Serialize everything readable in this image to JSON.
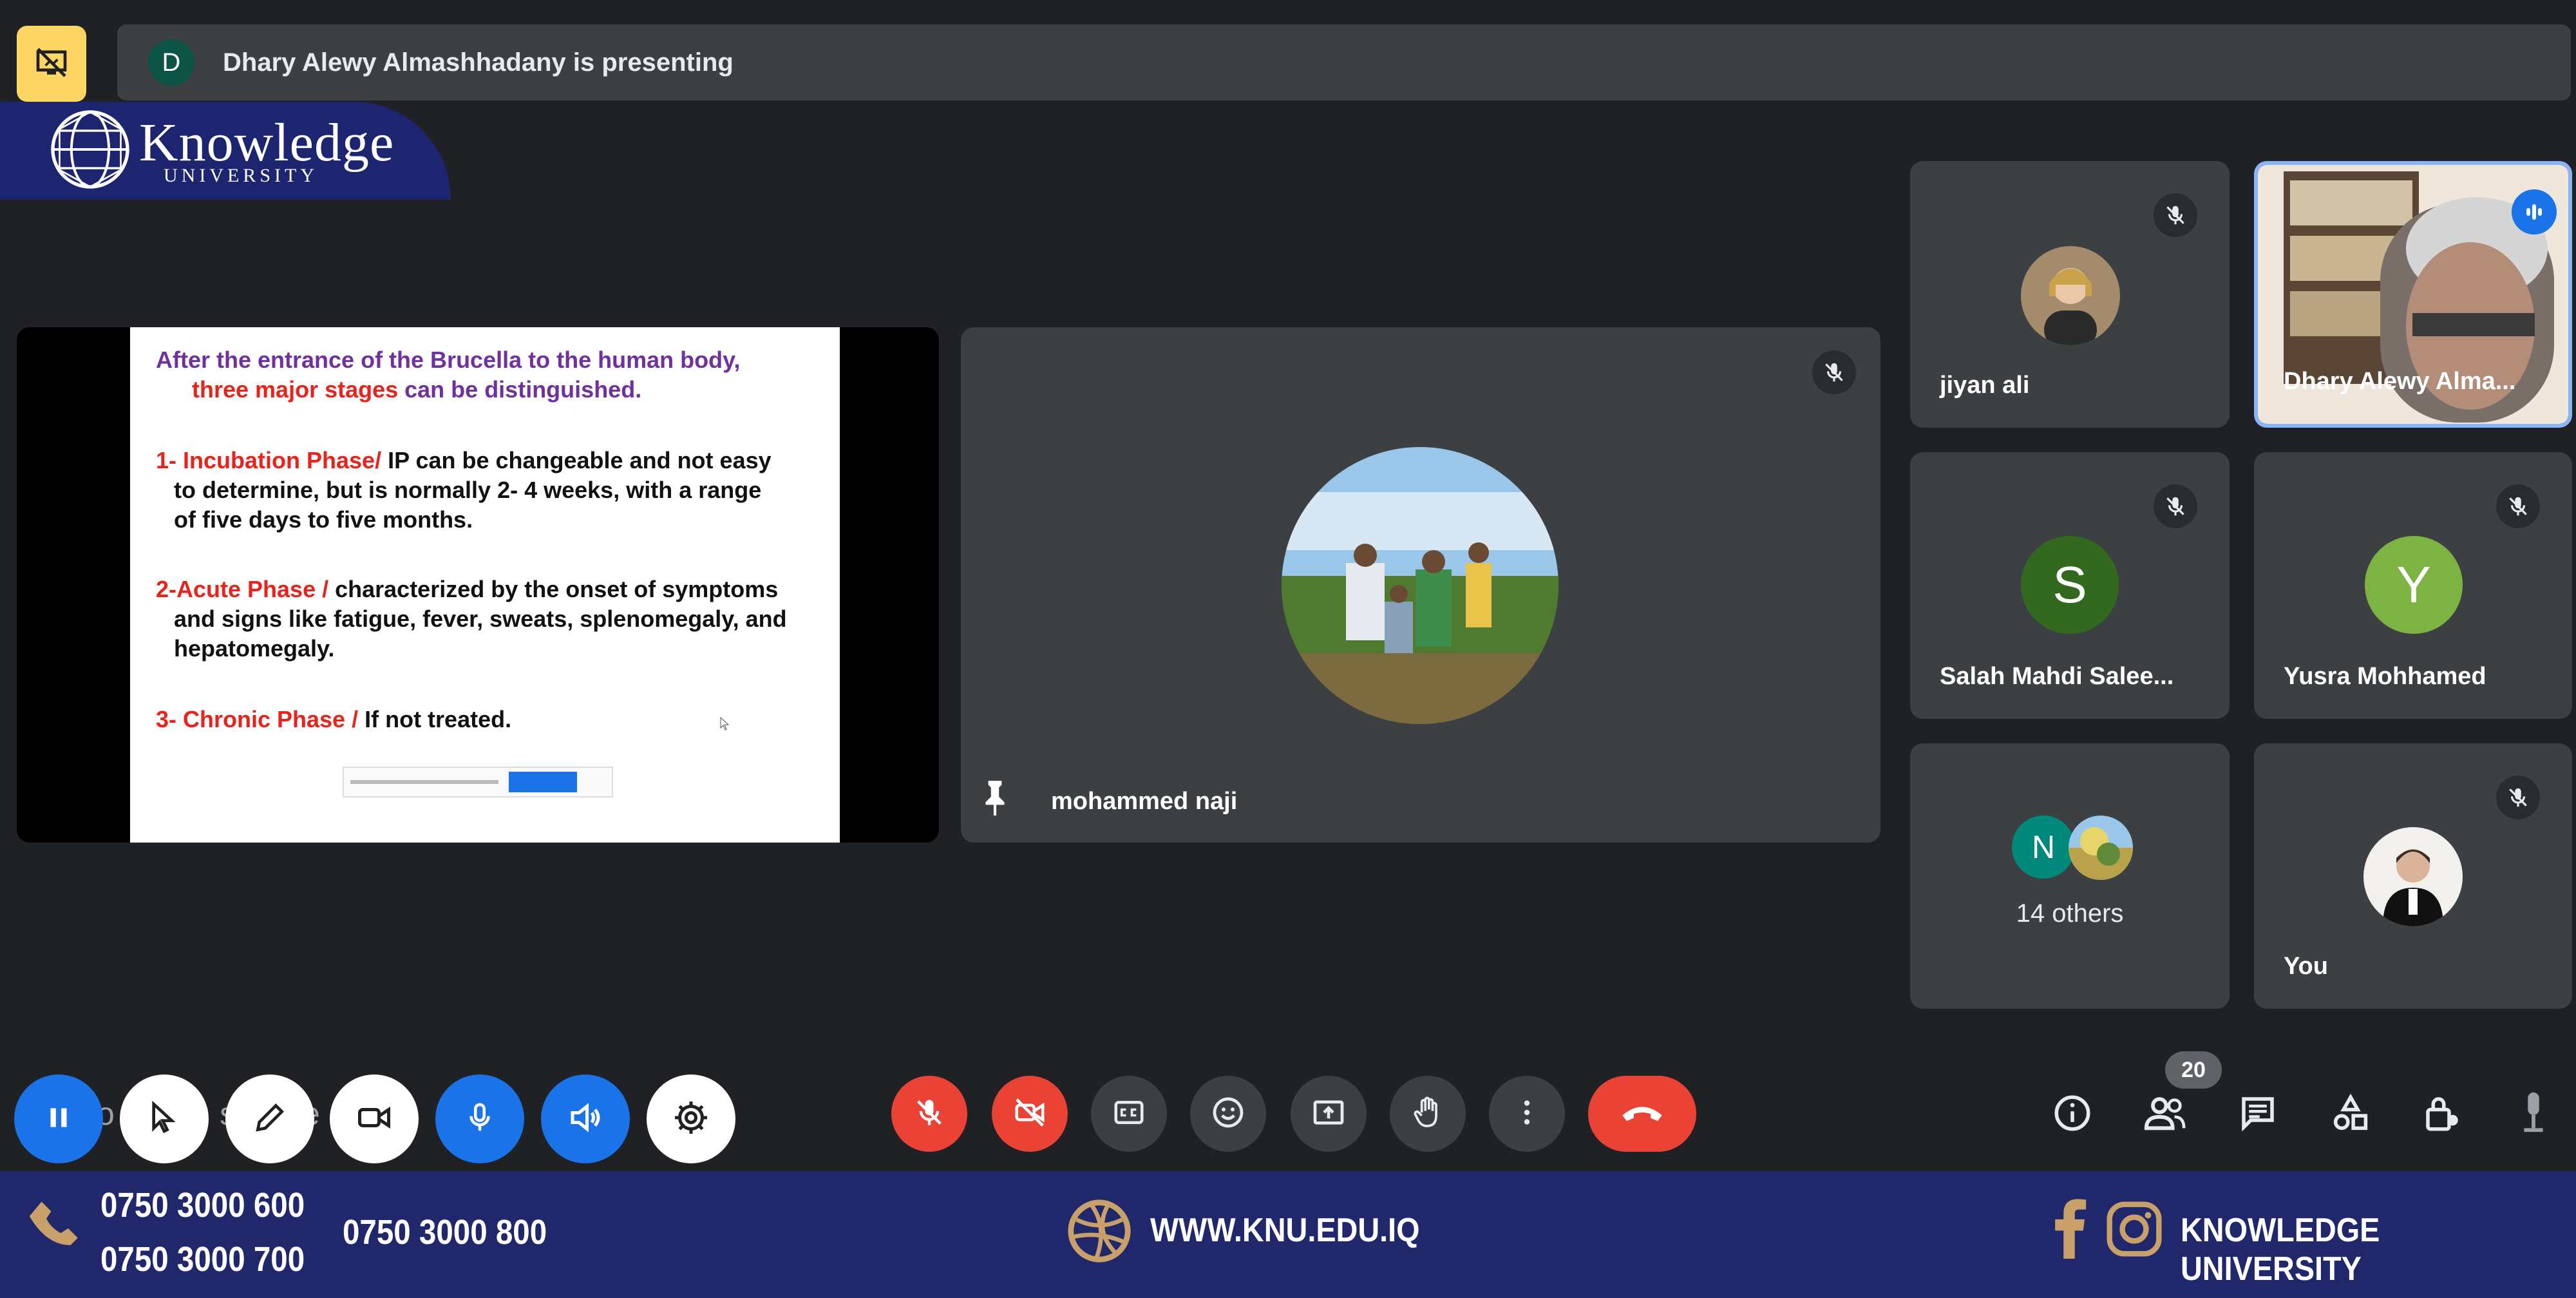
{
  "presenting_bar": {
    "avatar_initial": "D",
    "text": "Dhary Alewy Almashhadany is presenting"
  },
  "logo": {
    "word": "Knowledge",
    "sub": "UNIVERSITY"
  },
  "slide": {
    "heading_line1": "After the entrance of the Brucella to the human body,",
    "heading_red": "three major stages",
    "heading_rest": " can be distinguished.",
    "phase1_label": "1- Incubation Phase/",
    "phase1_line1": " IP  can be changeable and not easy",
    "phase1_line2": "to determine, but is normally 2- 4 weeks, with a range",
    "phase1_line3": "of five days to five months.",
    "phase2_label": "2-Acute Phase /",
    "phase2_line1": " characterized by the onset of symptoms",
    "phase2_line2": "and signs like fatigue, fever, sweats, splenomegaly, and",
    "phase2_line3": "hepatomegaly.",
    "phase3_label": "3- Chronic Phase /",
    "phase3_text": " If not treated."
  },
  "participants": {
    "main_pinned": {
      "name": "mohammed naji"
    },
    "jiyan": {
      "name": "jiyan ali"
    },
    "dhary": {
      "name": "Dhary Alewy Alma..."
    },
    "salah": {
      "name": "Salah Mahdi Salee...",
      "initial": "S",
      "color": "#33691e"
    },
    "yusra": {
      "name": "Yusra Mohhamed",
      "initial": "Y",
      "color": "#7cb342"
    },
    "others": {
      "label": "14 others",
      "initial": "N",
      "color": "#00897b"
    },
    "you": {
      "name": "You"
    }
  },
  "controls": {
    "participant_count": "20",
    "caption_strip": "o  an  Br  si  lu  le"
  },
  "footer": {
    "phone1": "0750 3000 600",
    "phone2": "0750 3000 700",
    "phone3": "0750 3000 800",
    "website": "WWW.KNU.EDU.IQ",
    "social": "KNOWLEDGE UNIVERSITY"
  },
  "colors": {
    "meet_bg": "#202124",
    "tile_bg": "#3c4043",
    "accent_blue": "#1a73e8",
    "danger_red": "#ea4335",
    "footer_navy": "#20286b",
    "footer_icon_gold": "#c9a06a"
  }
}
